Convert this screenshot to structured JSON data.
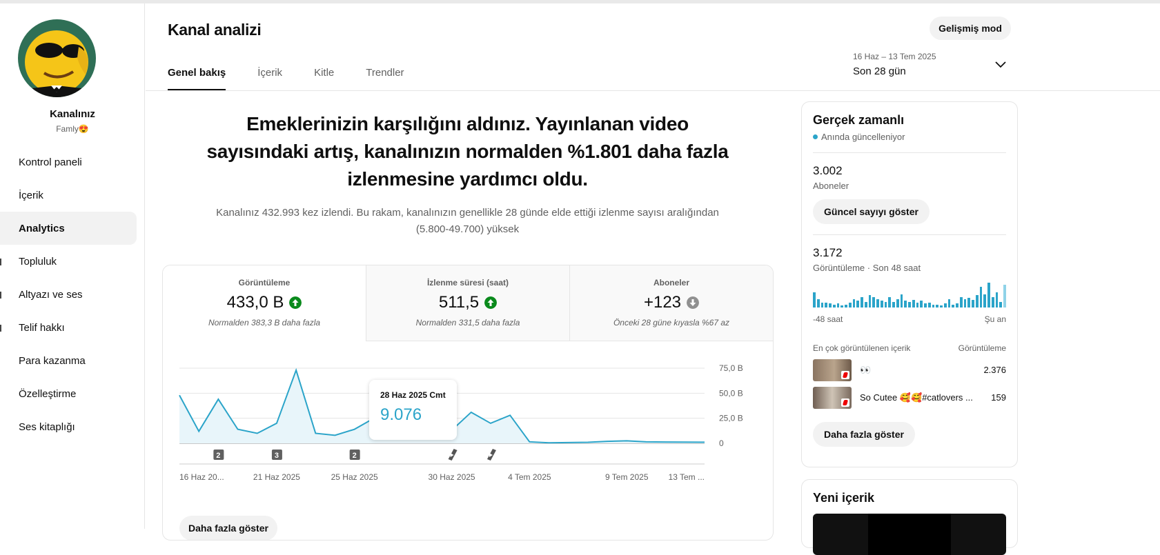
{
  "sidebar": {
    "channel_label": "Kanalınız",
    "channel_handle": "Famly😍",
    "items": [
      {
        "label": "Kontrol paneli"
      },
      {
        "label": "İçerik"
      },
      {
        "label": "Analytics"
      },
      {
        "label": "Topluluk"
      },
      {
        "label": "Altyazı ve ses"
      },
      {
        "label": "Telif hakkı"
      },
      {
        "label": "Para kazanma"
      },
      {
        "label": "Özelleştirme"
      },
      {
        "label": "Ses kitaplığı"
      }
    ]
  },
  "header": {
    "title": "Kanal analizi",
    "advanced_mode": "Gelişmiş mod",
    "tabs": [
      {
        "label": "Genel bakış"
      },
      {
        "label": "İçerik"
      },
      {
        "label": "Kitle"
      },
      {
        "label": "Trendler"
      }
    ],
    "date_range": "16 Haz – 13 Tem 2025",
    "period": "Son 28 gün"
  },
  "summary": {
    "headline": "Emeklerinizin karşılığını aldınız. Yayınlanan video sayısındaki artış, kanalınızın normalden %1.801 daha fazla izlenmesine yardımcı oldu.",
    "detail": "Kanalınız 432.993 kez izlendi. Bu rakam, kanalınızın genellikle 28 günde elde ettiği izlenme sayısı aralığından (5.800-49.700) yüksek"
  },
  "metrics": [
    {
      "label": "Görüntüleme",
      "value": "433,0 B",
      "trend": "up",
      "note": "Normalden 383,3 B daha fazla"
    },
    {
      "label": "İzlenme süresi (saat)",
      "value": "511,5",
      "trend": "up",
      "note": "Normalden 331,5 daha fazla"
    },
    {
      "label": "Aboneler",
      "value": "+123",
      "trend": "down",
      "note": "Önceki 28 güne kıyasla %67 az"
    }
  ],
  "chart_data": {
    "type": "area",
    "x": [
      "16 Haz",
      "17 Haz",
      "18 Haz",
      "19 Haz",
      "20 Haz",
      "21 Haz",
      "22 Haz",
      "23 Haz",
      "24 Haz",
      "25 Haz",
      "26 Haz",
      "27 Haz",
      "28 Haz",
      "29 Haz",
      "30 Haz",
      "1 Tem",
      "2 Tem",
      "3 Tem",
      "4 Tem",
      "5 Tem",
      "6 Tem",
      "7 Tem",
      "8 Tem",
      "9 Tem",
      "10 Tem",
      "11 Tem",
      "12 Tem",
      "13 Tem"
    ],
    "values": [
      48000,
      12000,
      44000,
      14000,
      10000,
      20000,
      73000,
      10000,
      8000,
      14000,
      25000,
      32000,
      9076,
      9000,
      13000,
      31000,
      20000,
      28000,
      1500,
      500,
      800,
      1000,
      2000,
      2500,
      1500,
      1300,
      1200,
      1100
    ],
    "y_ticks": [
      "75,0 B",
      "50,0 B",
      "25,0 B",
      "0"
    ],
    "x_ticks": [
      "16 Haz 20...",
      "21 Haz 2025",
      "25 Haz 2025",
      "30 Haz 2025",
      "4 Tem 2025",
      "9 Tem 2025",
      "13 Tem ..."
    ],
    "ylim": [
      0,
      75000
    ],
    "markers": [
      {
        "type": "count",
        "label": "2",
        "x_index": 2
      },
      {
        "type": "count",
        "label": "3",
        "x_index": 5
      },
      {
        "type": "count",
        "label": "2",
        "x_index": 9
      },
      {
        "type": "short",
        "label": "",
        "x_index": 14
      },
      {
        "type": "short",
        "label": "",
        "x_index": 16
      }
    ],
    "tooltip": {
      "date": "28 Haz 2025 Cmt",
      "value": "9.076",
      "x_index": 12
    }
  },
  "chart_more": "Daha fazla göster",
  "realtime": {
    "title": "Gerçek zamanlı",
    "live": "Anında güncelleniyor",
    "subs_value": "3.002",
    "subs_label": "Aboneler",
    "show_count": "Güncel sayıyı göster",
    "views_value": "3.172",
    "views_label": "Görüntüleme · Son 48 saat",
    "bars": [
      16,
      9,
      5,
      5,
      4,
      3,
      4,
      2,
      3,
      5,
      9,
      7,
      11,
      6,
      13,
      11,
      9,
      7,
      6,
      11,
      6,
      9,
      14,
      7,
      6,
      8,
      5,
      7,
      4,
      5,
      3,
      3,
      2,
      4,
      9,
      3,
      4,
      11,
      9,
      10,
      8,
      13,
      22,
      14,
      26,
      11,
      16,
      6,
      24
    ],
    "axis_left": "-48 saat",
    "axis_right": "Şu an",
    "top_header_left": "En çok görüntülenen içerik",
    "top_header_right": "Görüntüleme",
    "top_items": [
      {
        "title": "👀",
        "value": "2.376"
      },
      {
        "title": "So Cutee 🥰🥰#catlovers ...",
        "value": "159"
      }
    ],
    "more": "Daha fazla göster"
  },
  "new_content": {
    "title": "Yeni içerik"
  }
}
